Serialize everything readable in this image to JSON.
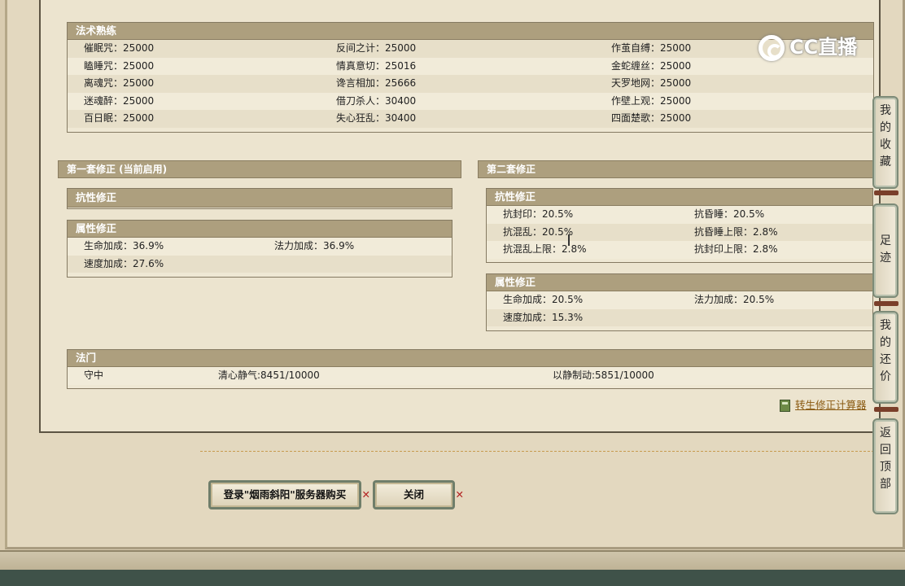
{
  "skill_section": {
    "title": "法术熟练",
    "rows": [
      [
        "催眠咒：25000",
        "反间之计：25000",
        "作茧自缚：25000"
      ],
      [
        "瞌睡咒：25000",
        "情真意切：25016",
        "金蛇缠丝：25000"
      ],
      [
        "离魂咒：25000",
        "谗言相加：25666",
        "天罗地网：25000"
      ],
      [
        "迷魂醉：25000",
        "借刀杀人：30400",
        "作壁上观：25000"
      ],
      [
        "百日眠：25000",
        "失心狂乱：30400",
        "四面楚歌：25000"
      ]
    ]
  },
  "suite1": {
    "title": "第一套修正 (当前启用)",
    "resist_title": "抗性修正",
    "attr_title": "属性修正",
    "attr_rows": [
      [
        "生命加成：36.9%",
        "法力加成：36.9%"
      ],
      [
        "速度加成：27.6%",
        ""
      ]
    ]
  },
  "suite2": {
    "title": "第二套修正",
    "resist_title": "抗性修正",
    "resist_rows": [
      [
        "抗封印：20.5%",
        "抗昏睡：20.5%"
      ],
      [
        "抗混乱：20.5%",
        "抗昏睡上限：2.8%"
      ],
      [
        "抗混乱上限：2.8%",
        "抗封印上限：2.8%"
      ]
    ],
    "attr_title": "属性修正",
    "attr_rows": [
      [
        "生命加成：20.5%",
        "法力加成：20.5%"
      ],
      [
        "速度加成：15.3%",
        ""
      ]
    ]
  },
  "famen": {
    "title": "法门",
    "row": [
      "守中",
      "清心静气:8451/10000",
      "以静制动:5851/10000"
    ]
  },
  "calculator_link": "转生修正计算器",
  "buttons": {
    "login_buy": "登录\"烟雨斜阳\"服务器购买",
    "close": "关闭"
  },
  "side_tabs": {
    "favorites": [
      "我",
      "的",
      "收",
      "藏"
    ],
    "footprints": [
      "足",
      "迹"
    ],
    "my_bargain": [
      "我",
      "的",
      "还",
      "价"
    ],
    "back_top": [
      "返",
      "回",
      "顶",
      "部"
    ]
  },
  "watermark": "CC直播",
  "icons": [
    "calculator-icon",
    "close-x-icon"
  ],
  "colors": {
    "header": "#ad9f7e",
    "panel": "#ece4cf",
    "link": "#8a5a12"
  }
}
